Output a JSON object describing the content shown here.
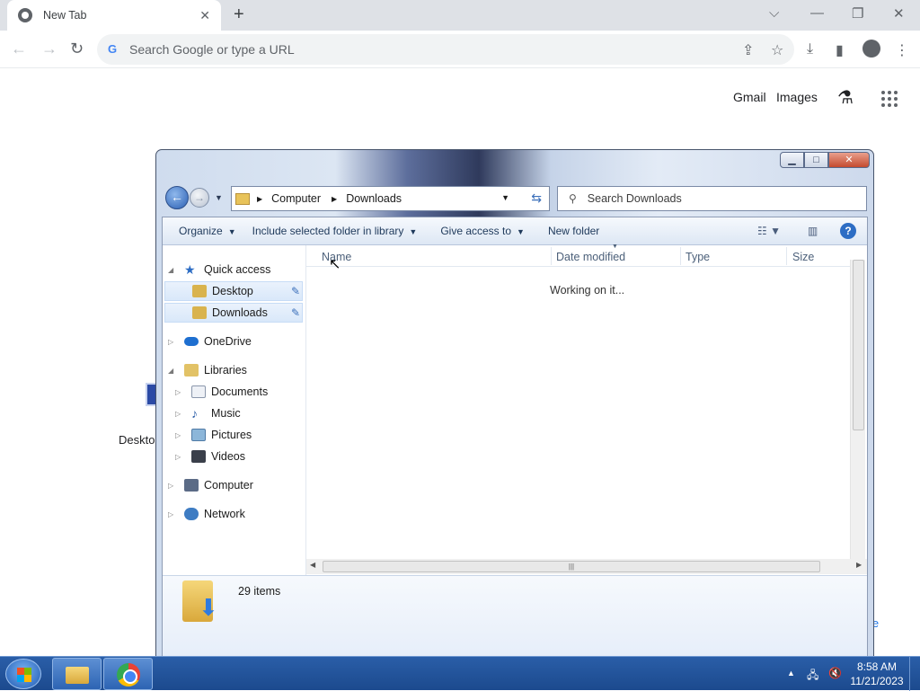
{
  "browser": {
    "tab_title": "New Tab",
    "tab_close": "✕",
    "new_tab": "+",
    "omnibox_placeholder": "Search Google or type a URL",
    "ntp": {
      "gmail": "Gmail",
      "images": "Images"
    },
    "bg_desktop_label": "Deskto",
    "bg_home_fragment": "me"
  },
  "explorer": {
    "address": {
      "crumbs": [
        "Computer",
        "Downloads"
      ]
    },
    "search_placeholder": "Search Downloads",
    "commands": [
      "Organize",
      "Include selected folder in library",
      "Give access to",
      "New folder"
    ],
    "help": "?",
    "nav": {
      "quick_access": "Quick access",
      "desktop": "Desktop",
      "downloads": "Downloads",
      "onedrive": "OneDrive",
      "libraries": "Libraries",
      "documents": "Documents",
      "music": "Music",
      "pictures": "Pictures",
      "videos": "Videos",
      "computer": "Computer",
      "network": "Network"
    },
    "columns": {
      "name": "Name",
      "date_modified": "Date modified",
      "type": "Type",
      "size": "Size"
    },
    "status": "Working on it...",
    "item_count": "29 items"
  },
  "taskbar": {
    "time": "8:58 AM",
    "date": "11/21/2023"
  }
}
